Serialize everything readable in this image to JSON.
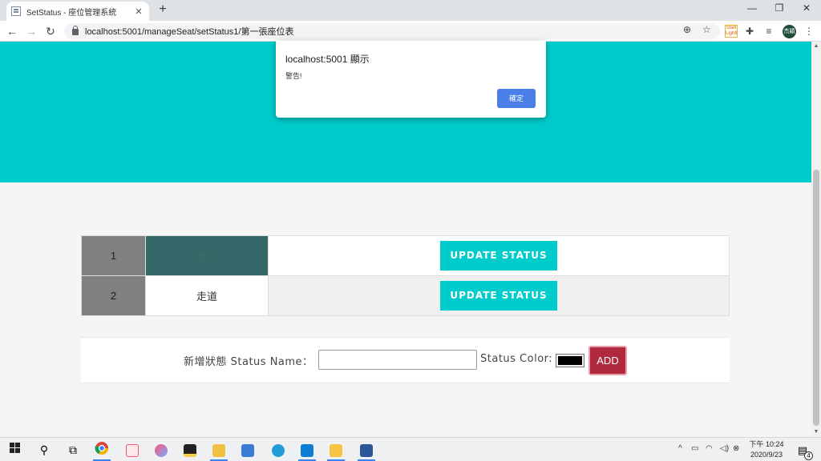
{
  "browser": {
    "tab_title": "SetStatus - 座位管理系統",
    "tab_close": "✕",
    "new_tab": "+",
    "url": "localhost:5001/manageSeat/setStatus1/第一張座位表",
    "window_controls": {
      "minimize": "—",
      "restore": "❐",
      "close": "✕"
    },
    "nav": {
      "back": "←",
      "forward": "→",
      "reload": "↻"
    },
    "ext_badge": "Start Lighthouse",
    "profile_label": "杰穎"
  },
  "dialog": {
    "title": "localhost:5001 顯示",
    "message": "警告!",
    "ok_label": "確定"
  },
  "table": {
    "rows": [
      {
        "number": "1",
        "name": "座位",
        "name_color": "#336666",
        "button": "UPDATE STATUS"
      },
      {
        "number": "2",
        "name": "走道",
        "name_color": "#ffffff",
        "button": "UPDATE STATUS"
      }
    ]
  },
  "add_form": {
    "name_label": "新增狀態 Status Name：",
    "name_value": "",
    "color_label": "Status Color:",
    "color_value": "#000000",
    "add_label": "ADD"
  },
  "taskbar": {
    "time": "下午 10:24",
    "date": "2020/9/23",
    "notifications": "4"
  },
  "colors": {
    "hero": "#00cccc",
    "update_button": "#00cccc",
    "add_button": "#b0293e",
    "dialog_ok": "#4a7fe8"
  }
}
